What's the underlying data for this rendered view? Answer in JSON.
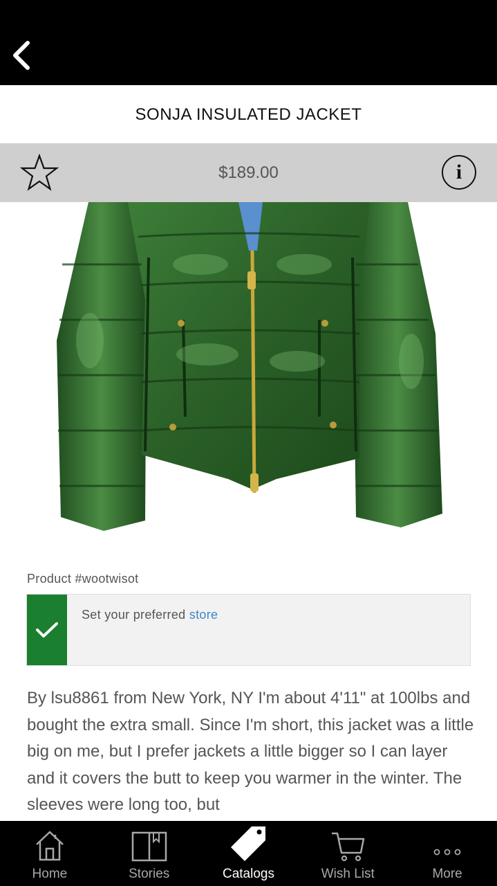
{
  "header": {
    "back_icon": "chevron-left-icon"
  },
  "product": {
    "title": "SONJA INSULATED JACKET",
    "price": "$189.00",
    "favorite_icon": "star-outline-icon",
    "info_icon": "info-icon",
    "info_glyph": "i",
    "number_label": "Product #wootwisot"
  },
  "store": {
    "check_icon": "check-icon",
    "prompt": "Set your preferred ",
    "link": "store"
  },
  "review": {
    "text": "By lsu8861 from New York, NY I'm about 4'11\" at 100lbs and bought the extra small. Since I'm short, this jacket was a little big on me, but I prefer jackets a little bigger so I can layer and it covers the butt to keep you warmer in the winter. The sleeves were long too, but"
  },
  "tabs": [
    {
      "label": "Home",
      "icon": "home-icon",
      "active": false
    },
    {
      "label": "Stories",
      "icon": "book-icon",
      "active": false
    },
    {
      "label": "Catalogs",
      "icon": "tag-icon",
      "active": true
    },
    {
      "label": "Wish List",
      "icon": "cart-icon",
      "active": false
    },
    {
      "label": "More",
      "icon": "more-icon",
      "active": false
    }
  ],
  "colors": {
    "accent_green": "#1a7f2e",
    "link_blue": "#3a86c8",
    "price_bar_gray": "#cfcfcf",
    "jacket_green": "#2f6b2c"
  }
}
